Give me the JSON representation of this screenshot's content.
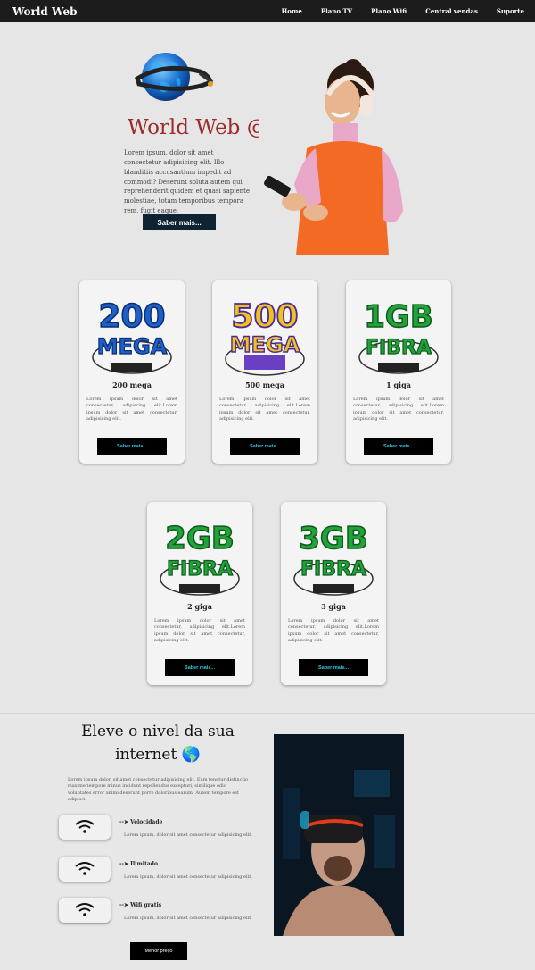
{
  "nav": {
    "brand": "World Web",
    "links": [
      "Home",
      "Plano TV",
      "Plano Wifi",
      "Central vendas",
      "Suporte"
    ]
  },
  "hero": {
    "title": "World Web @",
    "text": "Lorem ipsum, dolor sit amet consectetur adipisicing elit. Illo blanditiis accusantium impedit ad commodi? Deserunt soluta autem qui reprehenderit quidem et quasi sapiente molestiae, totam temporibus tempora rem, fugit eaque.",
    "button": "Saber mais..."
  },
  "cards": [
    {
      "badge_top": "200",
      "badge_bottom": "MEGA",
      "title": "200 mega",
      "text": "Lorem ipsum dolor sit amet consectetur, adipiscing elit.Lorem ipsum dolor sit amet consectetur, adipisicing elit.",
      "button": "Saber mais...",
      "color": "#1f5fc8"
    },
    {
      "badge_top": "500",
      "badge_bottom": "MEGA",
      "title": "500 mega",
      "text": "Lorem ipsum dolor sit amet consectetur, adipisicing elit.Lorem ipsum dolor sit amet consectetur, adipisicing elit.",
      "button": "Saber mais...",
      "color": "#f2c21b"
    },
    {
      "badge_top": "1GB",
      "badge_bottom": "FIBRA",
      "title": "1 giga",
      "text": "Lorem ipsum dolor sit amet consectetur, adipisicing elit.Lorem ipsum dolor sit amet consectetur, adipisicing elit.",
      "button": "Saber mais...",
      "color": "#22a33a"
    },
    {
      "badge_top": "2GB",
      "badge_bottom": "FIBRA",
      "title": "2 giga",
      "text": "Lorem ipsum dolor sit amet consectetur, adipisicing elit.Lorem ipsum dolor sit amet consectetur, adipisicing elit.",
      "button": "Saber mais...",
      "color": "#22a33a"
    },
    {
      "badge_top": "3GB",
      "badge_bottom": "FIBRA",
      "title": "3 giga",
      "text": "Lorem ipsum dolor sit amet consectetur, adipisicing elit.Lorem ipsum dolor sit amet consectetur, adipisicing elit.",
      "button": "Saber mais...",
      "color": "#22a33a"
    }
  ],
  "section3": {
    "title": "Eleve o nivel da sua internet 🌎",
    "text": "Lorem ipsum dolor, sit amet consectetur adipisicing elit. Eum tenetur distinctio maxime tempore minus incidunt repellendus excepturi, similique odio voluptates error animi deserunt porro doloribus earum! Autem tempore est adipisci.",
    "features": [
      {
        "label": "--➤ Velocidade",
        "desc": "Lorem ipsum, dolor sit amet consectetur adipisicing elit."
      },
      {
        "label": "--➤ Ilimitado",
        "desc": "Lorem ipsum, dolor sit amet consectetur adipisicing elit."
      },
      {
        "label": "--➤ Wifi gratis",
        "desc": "Lorem ipsum, dolor sit amet consectetur adipisicing elit."
      }
    ],
    "button": "Menor preço"
  }
}
